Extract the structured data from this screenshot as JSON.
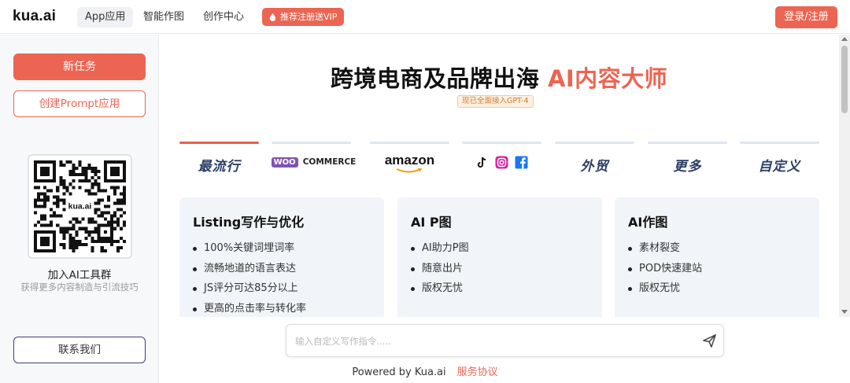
{
  "header": {
    "logo": "kua.ai",
    "nav": [
      "App应用",
      "智能作图",
      "创作中心"
    ],
    "vip_label": "推荐注册送VIP",
    "login_label": "登录/注册"
  },
  "sidebar": {
    "new_task": "新任务",
    "create_prompt": "创建Prompt应用",
    "qr_center": "kua.ai",
    "qr_title": "加入AI工具群",
    "qr_subtitle": "获得更多内容制造与引流技巧",
    "contact": "联系我们"
  },
  "hero": {
    "title_main": "跨境电商及品牌出海 ",
    "title_accent": "AI内容大师",
    "badge": "现已全面接入GPT-4"
  },
  "tabs": {
    "popular": "最流行",
    "woo_badge": "WOO",
    "woo_text": "COMMERCE",
    "amazon": "amazon",
    "foreign_trade": "外贸",
    "more": "更多",
    "custom": "自定义"
  },
  "cards": [
    {
      "title": "Listing写作与优化",
      "items": [
        "100%关键词埋词率",
        "流畅地道的语言表达",
        "JS评分可达85分以上",
        "更高的点击率与转化率"
      ]
    },
    {
      "title": "AI P图",
      "items": [
        "AI助力P图",
        "随意出片",
        "版权无忧"
      ]
    },
    {
      "title": "AI作图",
      "items": [
        "素材裂变",
        "POD快速建站",
        "版权无忧"
      ]
    }
  ],
  "input": {
    "placeholder": "输入自定义写作指令....."
  },
  "footer": {
    "powered": "Powered by Kua.ai",
    "terms": "服务协议"
  },
  "colors": {
    "accent": "#ec6552",
    "card_bg": "#f1f4f9",
    "tab_active": "#e8604c"
  }
}
